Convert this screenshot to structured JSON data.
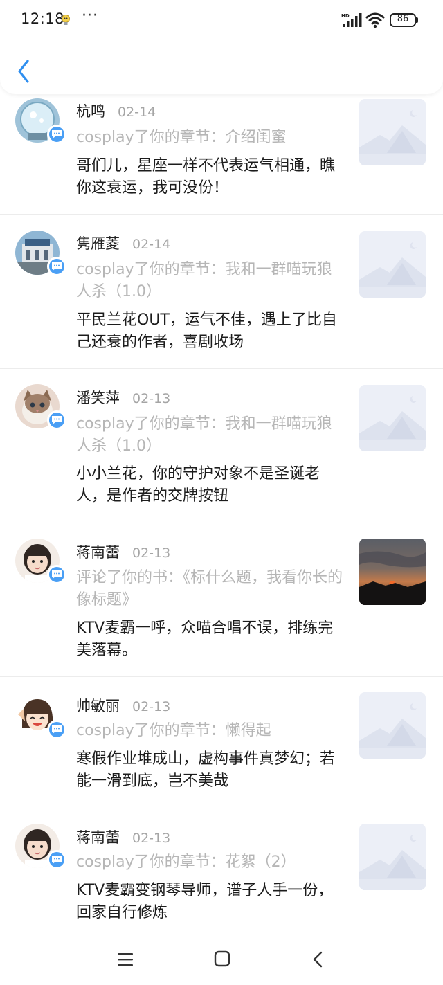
{
  "status": {
    "time": "12:18",
    "dots": "···",
    "battery": "86",
    "network": "HD"
  },
  "colors": {
    "accent": "#2f8ff0",
    "badge": "#4a9ff5",
    "meta": "#b6b6b6"
  },
  "items": [
    {
      "name": "杭鸣",
      "date": "02-14",
      "meta": "cosplay了你的章节：介绍闺蜜",
      "content": "哥们儿，星座一样不代表运气相通，瞧你这衰运，我可没份！"
    },
    {
      "name": "隽雁菱",
      "date": "02-14",
      "meta": "cosplay了你的章节：我和一群喵玩狼人杀（1.0）",
      "content": "平民兰花OUT，运气不佳，遇上了比自己还衰的作者，喜剧收场"
    },
    {
      "name": "潘笑萍",
      "date": "02-13",
      "meta": "cosplay了你的章节：我和一群喵玩狼人杀（1.0）",
      "content": "小小兰花，你的守护对象不是圣诞老人，是作者的交牌按钮"
    },
    {
      "name": "蒋南蕾",
      "date": "02-13",
      "meta": "评论了你的书：《标什么题，我看你长的像标题》",
      "content": "KTV麦霸一呼，众喵合唱不误，排练完美落幕。"
    },
    {
      "name": "帅敏丽",
      "date": "02-13",
      "meta": "cosplay了你的章节：懒得起",
      "content": "寒假作业堆成山，虚构事件真梦幻；若能一滑到底，岂不美哉"
    },
    {
      "name": "蒋南蕾",
      "date": "02-13",
      "meta": "cosplay了你的章节：花絮（2）",
      "content": "KTV麦霸变钢琴导师，谱子人手一份，回家自行修炼"
    }
  ]
}
